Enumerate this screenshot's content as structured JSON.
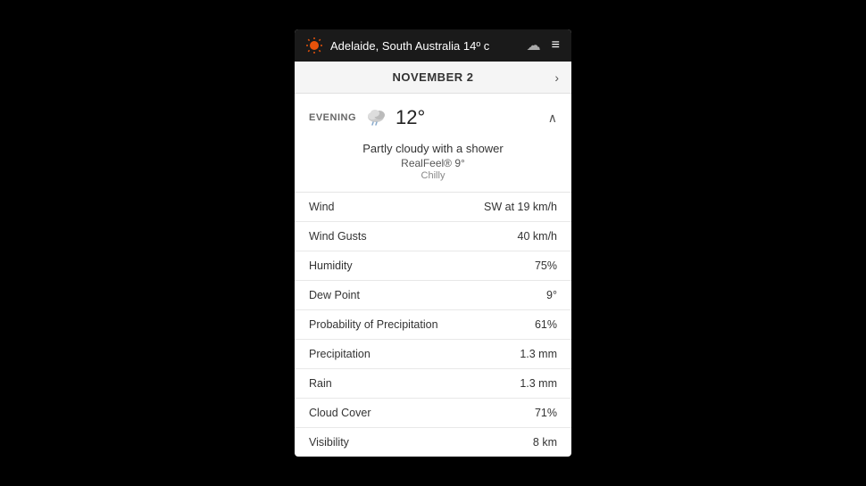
{
  "header": {
    "title": "Adelaide, South Australia  14º c",
    "cloud_icon": "☁",
    "menu_icon": "≡",
    "sun_color": "#e8520a"
  },
  "date_bar": {
    "label": "NOVEMBER 2",
    "chevron": "›"
  },
  "evening": {
    "label": "EVENING",
    "temperature": "12°",
    "chevron_up": "∧"
  },
  "description": {
    "condition": "Partly cloudy with a shower",
    "realfeel": "RealFeel® 9°",
    "chill": "Chilly"
  },
  "rows": [
    {
      "label": "Wind",
      "value": "SW at 19 km/h"
    },
    {
      "label": "Wind Gusts",
      "value": "40 km/h"
    },
    {
      "label": "Humidity",
      "value": "75%"
    },
    {
      "label": "Dew Point",
      "value": "9°"
    },
    {
      "label": "Probability of Precipitation",
      "value": "61%"
    },
    {
      "label": "Precipitation",
      "value": "1.3 mm"
    },
    {
      "label": "Rain",
      "value": "1.3 mm"
    },
    {
      "label": "Cloud Cover",
      "value": "71%"
    },
    {
      "label": "Visibility",
      "value": "8 km"
    }
  ]
}
